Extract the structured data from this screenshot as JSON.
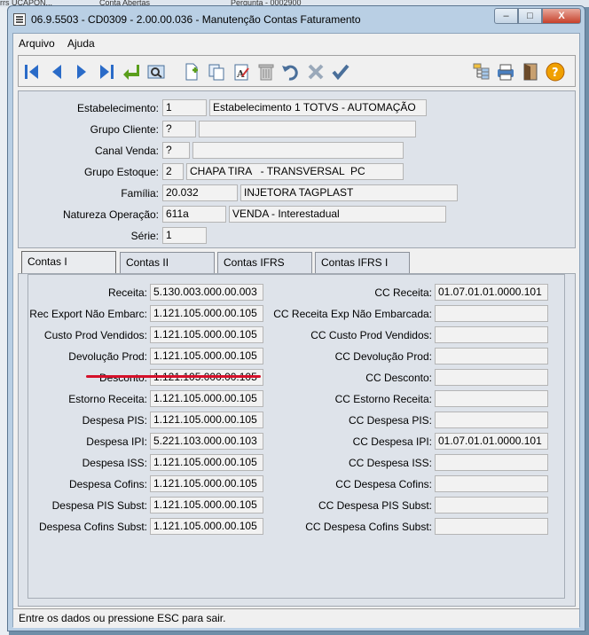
{
  "background": {
    "tabs": [
      "rrs UCAPON...",
      "Conta Abertas",
      "Pergunta - 0002900"
    ]
  },
  "window": {
    "title": "06.9.5503 - CD0309 - 2.00.00.036 - Manutenção Contas Faturamento",
    "controls": {
      "minimize": "–",
      "maximize": "□",
      "close": "X"
    }
  },
  "menu": {
    "items": [
      "Arquivo",
      "Ajuda"
    ]
  },
  "toolbar": {
    "icons": [
      "first-record-icon",
      "previous-record-icon",
      "next-record-icon",
      "last-record-icon",
      "goto-icon",
      "search-icon",
      "new-record-icon",
      "copy-record-icon",
      "edit-record-icon",
      "delete-record-icon",
      "undo-icon",
      "cancel-icon",
      "save-icon",
      "tree-icon",
      "print-icon",
      "exit-icon",
      "help-icon"
    ]
  },
  "header": {
    "labels": {
      "estabelecimento": "Estabelecimento:",
      "grupo_cliente": "Grupo Cliente:",
      "canal_venda": "Canal Venda:",
      "grupo_estoque": "Grupo Estoque:",
      "familia": "Família:",
      "natureza": "Natureza Operação:",
      "serie": "Série:"
    },
    "values": {
      "estabelecimento_code": "1",
      "estabelecimento_desc": "Estabelecimento 1 TOTVS - AUTOMAÇÃO",
      "grupo_cliente_code": "?",
      "grupo_cliente_desc": "",
      "canal_venda_code": "?",
      "canal_venda_desc": "",
      "grupo_estoque_code": "2",
      "grupo_estoque_desc": "CHAPA TIRA   - TRANSVERSAL  PC",
      "familia_code": "20.032",
      "familia_desc": "INJETORA TAGPLAST",
      "natureza_code": "611a",
      "natureza_desc": "VENDA - Interestadual",
      "serie": "1"
    }
  },
  "tabs": [
    "Contas I",
    "Contas II",
    "Contas IFRS",
    "Contas IFRS I"
  ],
  "contas": {
    "left_labels": [
      "Receita:",
      "Rec Export Não Embarc:",
      "Custo Prod Vendidos:",
      "Devolução Prod:",
      "Desconto:",
      "Estorno Receita:",
      "Despesa PIS:",
      "Despesa IPI:",
      "Despesa ISS:",
      "Despesa Cofins:",
      "Despesa PIS Subst:",
      "Despesa Cofins Subst:"
    ],
    "left_values": [
      "5.130.003.000.00.003",
      "1.121.105.000.00.105",
      "1.121.105.000.00.105",
      "1.121.105.000.00.105",
      "1.121.105.000.00.105",
      "1.121.105.000.00.105",
      "1.121.105.000.00.105",
      "5.221.103.000.00.103",
      "1.121.105.000.00.105",
      "1.121.105.000.00.105",
      "1.121.105.000.00.105",
      "1.121.105.000.00.105"
    ],
    "right_labels": [
      "CC Receita:",
      "CC Receita Exp Não Embarcada:",
      "CC Custo Prod Vendidos:",
      "CC Devolução Prod:",
      "CC Desconto:",
      "CC Estorno Receita:",
      "CC Despesa PIS:",
      "CC Despesa IPI:",
      "CC Despesa ISS:",
      "CC Despesa Cofins:",
      "CC Despesa PIS Subst:",
      "CC Despesa Cofins Subst:"
    ],
    "right_values": [
      "01.07.01.01.0000.101",
      "",
      "",
      "",
      "",
      "",
      "",
      "01.07.01.01.0000.101",
      "",
      "",
      "",
      ""
    ]
  },
  "status": {
    "message": "Entre os dados ou pressione ESC para sair."
  },
  "colors": {
    "highlight_underline": "#d5102a",
    "nav_blue": "#2a6bc8",
    "help_orange": "#f0a000"
  }
}
